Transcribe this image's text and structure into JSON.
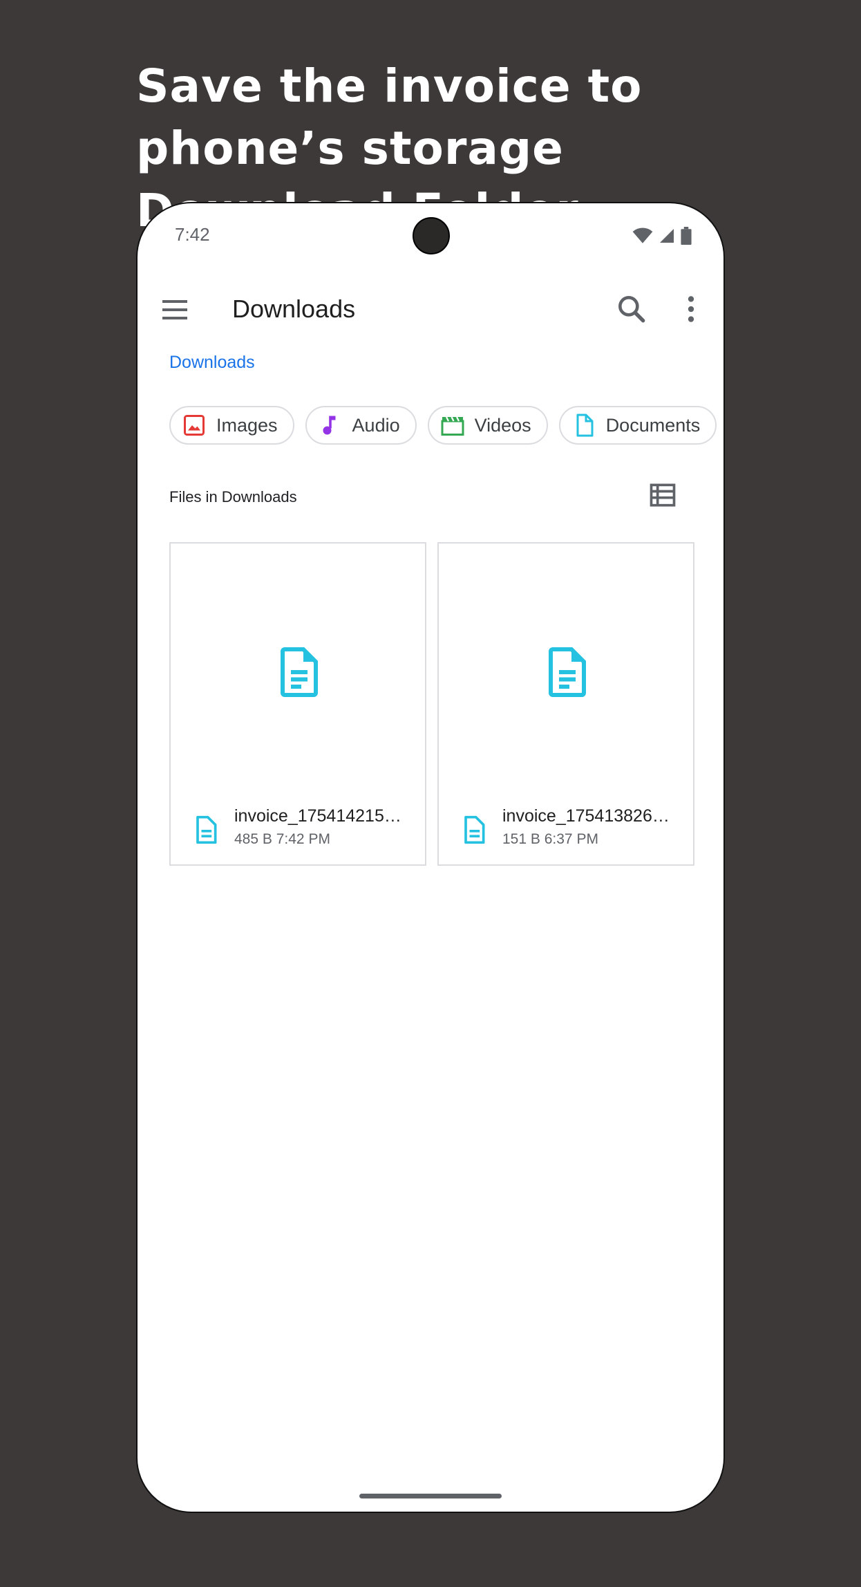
{
  "headline": "Save the invoice to phone’s storage Download Folder",
  "status_bar": {
    "time": "7:42"
  },
  "app_bar": {
    "title": "Downloads"
  },
  "breadcrumb": "Downloads",
  "chips": [
    {
      "label": "Images",
      "icon": "image-icon",
      "color": "#e53935"
    },
    {
      "label": "Audio",
      "icon": "audio-icon",
      "color": "#9334e6"
    },
    {
      "label": "Videos",
      "icon": "video-icon",
      "color": "#34a853"
    },
    {
      "label": "Documents",
      "icon": "document-icon",
      "color": "#24c1e0"
    }
  ],
  "section_label": "Files in Downloads",
  "files": [
    {
      "name": "invoice_175414215…",
      "size": "485 B",
      "time": "7:42 PM"
    },
    {
      "name": "invoice_175413826…",
      "size": "151 B",
      "time": "6:37 PM"
    }
  ],
  "colors": {
    "accent": "#1a73e8",
    "doc_icon": "#24c1e0",
    "background": "#3d3938"
  }
}
